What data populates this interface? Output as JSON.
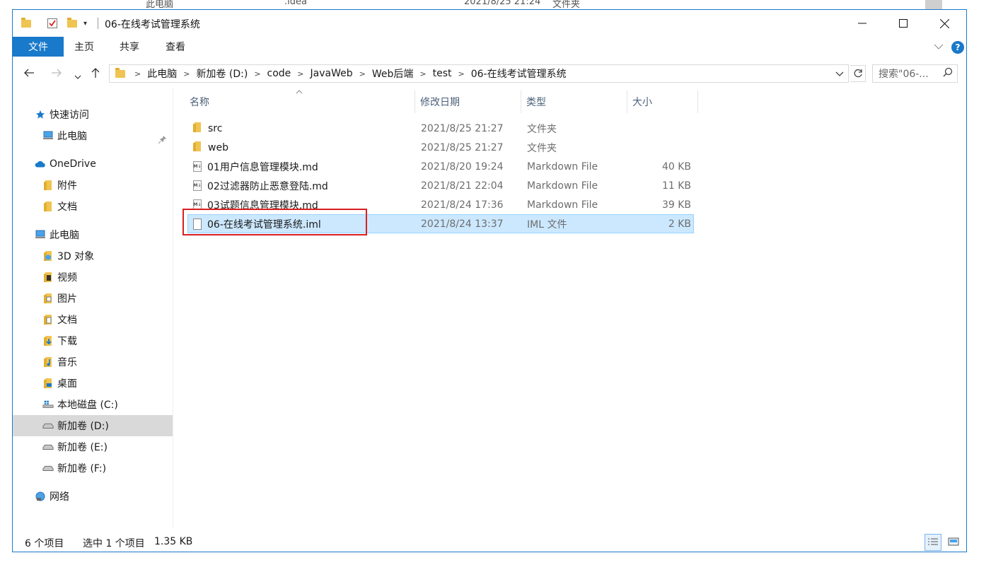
{
  "background": {
    "fragment_left": "此电脑",
    "fragment_name": ".idea",
    "fragment_date": "2021/8/25 21:24",
    "fragment_type": "文件夹"
  },
  "window": {
    "title": "06-在线考试管理系统",
    "accent": "#1979ca"
  },
  "ribbon": {
    "tabs": [
      "文件",
      "主页",
      "共享",
      "查看"
    ],
    "help": "?"
  },
  "address": {
    "crumbs": [
      "此电脑",
      "新加卷 (D:)",
      "code",
      "JavaWeb",
      "Web后端",
      "test",
      "06-在线考试管理系统"
    ],
    "search_placeholder": "搜索\"06-..."
  },
  "nav": {
    "items": [
      {
        "label": "快速访问",
        "icon": "star-icon"
      },
      {
        "label": "此电脑",
        "icon": "computer-icon"
      },
      {
        "label": "OneDrive",
        "icon": "cloud-icon"
      },
      {
        "label": "附件",
        "icon": "folder-icon"
      },
      {
        "label": "文档",
        "icon": "folder-icon"
      },
      {
        "label": "此电脑",
        "icon": "computer-icon"
      },
      {
        "label": "3D 对象",
        "icon": "3d-objects-icon"
      },
      {
        "label": "视频",
        "icon": "video-icon"
      },
      {
        "label": "图片",
        "icon": "pictures-icon"
      },
      {
        "label": "文档",
        "icon": "documents-icon"
      },
      {
        "label": "下载",
        "icon": "download-icon"
      },
      {
        "label": "音乐",
        "icon": "music-icon"
      },
      {
        "label": "桌面",
        "icon": "desktop-icon"
      },
      {
        "label": "本地磁盘 (C:)",
        "icon": "windows-drive-icon"
      },
      {
        "label": "新加卷 (D:)",
        "icon": "drive-icon",
        "selected": true
      },
      {
        "label": "新加卷 (E:)",
        "icon": "drive-icon"
      },
      {
        "label": "新加卷 (F:)",
        "icon": "drive-icon"
      },
      {
        "label": "网络",
        "icon": "network-icon"
      }
    ]
  },
  "columns": {
    "name": "名称",
    "modified": "修改日期",
    "type": "类型",
    "size": "大小"
  },
  "files": [
    {
      "name": "src",
      "modified": "2021/8/25 21:27",
      "type": "文件夹",
      "size": "",
      "icon": "folder-icon"
    },
    {
      "name": "web",
      "modified": "2021/8/25 21:27",
      "type": "文件夹",
      "size": "",
      "icon": "folder-icon"
    },
    {
      "name": "01用户信息管理模块.md",
      "modified": "2021/8/20 19:24",
      "type": "Markdown File",
      "size": "40 KB",
      "icon": "markdown-file-icon"
    },
    {
      "name": "02过滤器防止恶意登陆.md",
      "modified": "2021/8/21 22:04",
      "type": "Markdown File",
      "size": "11 KB",
      "icon": "markdown-file-icon"
    },
    {
      "name": "03试题信息管理模块.md",
      "modified": "2021/8/24 17:36",
      "type": "Markdown File",
      "size": "39 KB",
      "icon": "markdown-file-icon"
    },
    {
      "name": "06-在线考试管理系统.iml",
      "modified": "2021/8/24 13:37",
      "type": "IML 文件",
      "size": "2 KB",
      "icon": "file-icon",
      "selected": true
    }
  ],
  "status": {
    "count": "6 个项目",
    "selection": "选中 1 个项目",
    "size": "1.35 KB"
  },
  "highlight_color": "#d9201f"
}
